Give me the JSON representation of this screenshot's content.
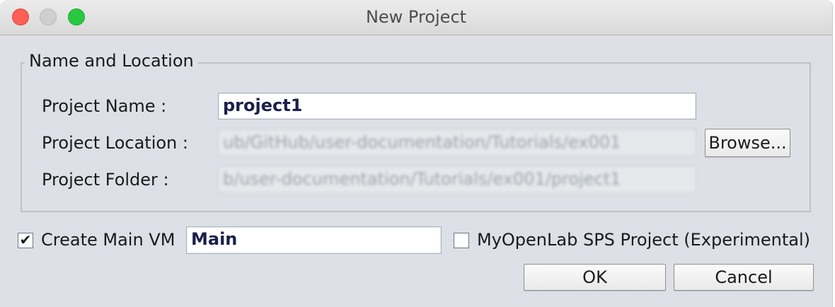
{
  "window": {
    "title": "New Project"
  },
  "name_location": {
    "legend": "Name and Location",
    "project_name": {
      "label": "Project Name :",
      "value": "project1"
    },
    "project_location": {
      "label": "Project Location :",
      "value": "ub/GitHub/user-documentation/Tutorials/ex001"
    },
    "project_folder": {
      "label": "Project Folder :",
      "value": "b/user-documentation/Tutorials/ex001/project1"
    },
    "browse_label": "Browse..."
  },
  "options": {
    "create_main_vm": {
      "label": "Create Main VM",
      "checked": true,
      "check_glyph": "✔",
      "value": "Main"
    },
    "sps_project": {
      "label": "MyOpenLab SPS Project (Experimental)",
      "checked": false
    }
  },
  "buttons": {
    "ok_label": "OK",
    "cancel_label": "Cancel"
  },
  "colors": {
    "close": "#fe5f57",
    "minimize": "#cfcfcf",
    "maximize": "#28c840",
    "window_bg": "#dde0e6",
    "field_text": "#1b1f4a"
  }
}
